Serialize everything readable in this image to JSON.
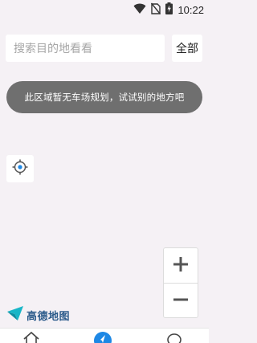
{
  "status_bar": {
    "time": "10:22",
    "icons": [
      "wifi-icon",
      "no-sim-icon",
      "battery-charging-icon"
    ]
  },
  "search": {
    "placeholder": "搜索目的地看看",
    "all_button_label": "全部"
  },
  "toast": {
    "message": "此区域暂无车场规划，试试别的地方吧"
  },
  "map_controls": {
    "locate_icon": "locate-icon",
    "zoom_in_icon": "plus-icon",
    "zoom_out_icon": "minus-icon"
  },
  "map_logo": {
    "text": "高德地图"
  },
  "bottom_nav": {
    "items": [
      {
        "icon": "home-icon"
      },
      {
        "icon": "navigate-icon"
      },
      {
        "icon": "message-icon"
      }
    ]
  },
  "colors": {
    "background": "#f5f1f5",
    "toast_bg": "#6f6f6f",
    "accent": "#1e88e5",
    "logo_teal": "#19b6c7"
  }
}
